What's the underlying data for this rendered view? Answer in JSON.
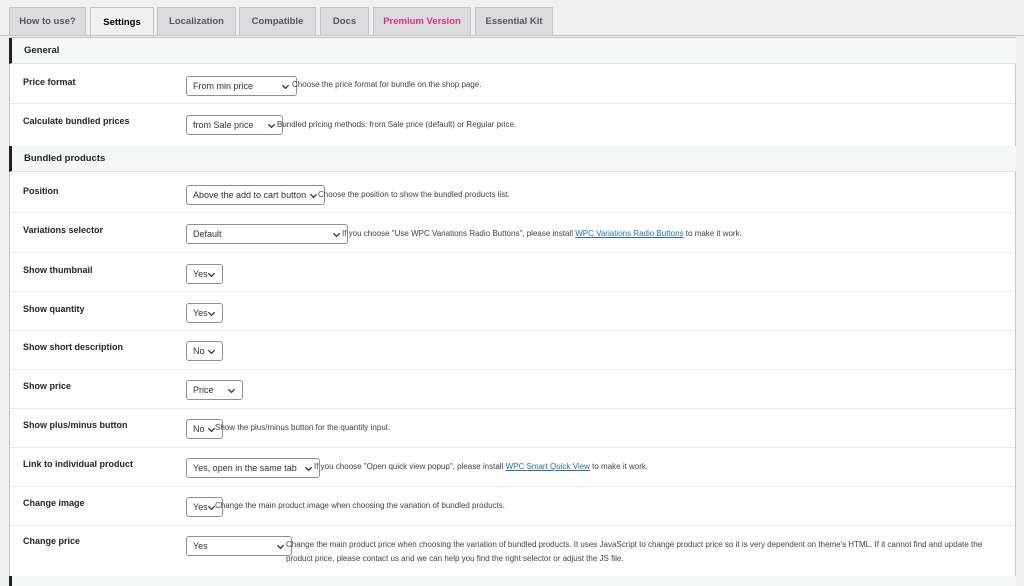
{
  "tabs": [
    {
      "label": "How to use?"
    },
    {
      "label": "Settings"
    },
    {
      "label": "Localization"
    },
    {
      "label": "Compatible"
    },
    {
      "label": "Docs"
    },
    {
      "label": "Premium Version"
    },
    {
      "label": "Essential Kit"
    }
  ],
  "sections": {
    "general": "General",
    "bundled": "Bundled products"
  },
  "rows": {
    "price_format": {
      "label": "Price format",
      "value": "From min price",
      "desc": "Choose the price format for bundle on the shop page."
    },
    "calc_prices": {
      "label": "Calculate bundled prices",
      "value": "from Sale price",
      "desc": "Bundled pricing methods: from Sale price (default) or Regular price."
    },
    "position": {
      "label": "Position",
      "value": "Above the add to cart button",
      "desc": "Choose the position to show the bundled products list."
    },
    "variations": {
      "label": "Variations selector",
      "value": "Default",
      "desc_pre": "If you choose \"Use WPC Variations Radio Buttons\", please install",
      "link": "WPC Variations Radio Buttons",
      "desc_post": "to make it work."
    },
    "thumbnail": {
      "label": "Show thumbnail",
      "value": "Yes"
    },
    "quantity": {
      "label": "Show quantity",
      "value": "Yes"
    },
    "short_desc": {
      "label": "Show short description",
      "value": "No"
    },
    "price": {
      "label": "Show price",
      "value": "Price"
    },
    "plus_minus": {
      "label": "Show plus/minus button",
      "value": "No",
      "desc": "Show the plus/minus button for the quantity input."
    },
    "link_individual": {
      "label": "Link to individual product",
      "value": "Yes, open in the same tab",
      "desc_pre": "If you choose \"Open quick view popup\", please install",
      "link": "WPC Smart Quick View",
      "desc_post": "to make it work."
    },
    "change_image": {
      "label": "Change image",
      "value": "Yes",
      "desc": "Change the main product image when choosing the variation of bundled products."
    },
    "change_price": {
      "label": "Change price",
      "value": "Yes",
      "desc": "Change the main product price when choosing the variation of bundled products. It uses JavaScript to change product price so it is very dependent on theme's HTML. If it cannot find and update the product price, please contact us and we can help you find the right selector or adjust the JS file."
    }
  },
  "icons": {
    "select_arrow": "chevron-down-icon"
  },
  "colors": {
    "premium": "#d63384",
    "link": "#2271b1",
    "section_bar": "#1d2327"
  }
}
